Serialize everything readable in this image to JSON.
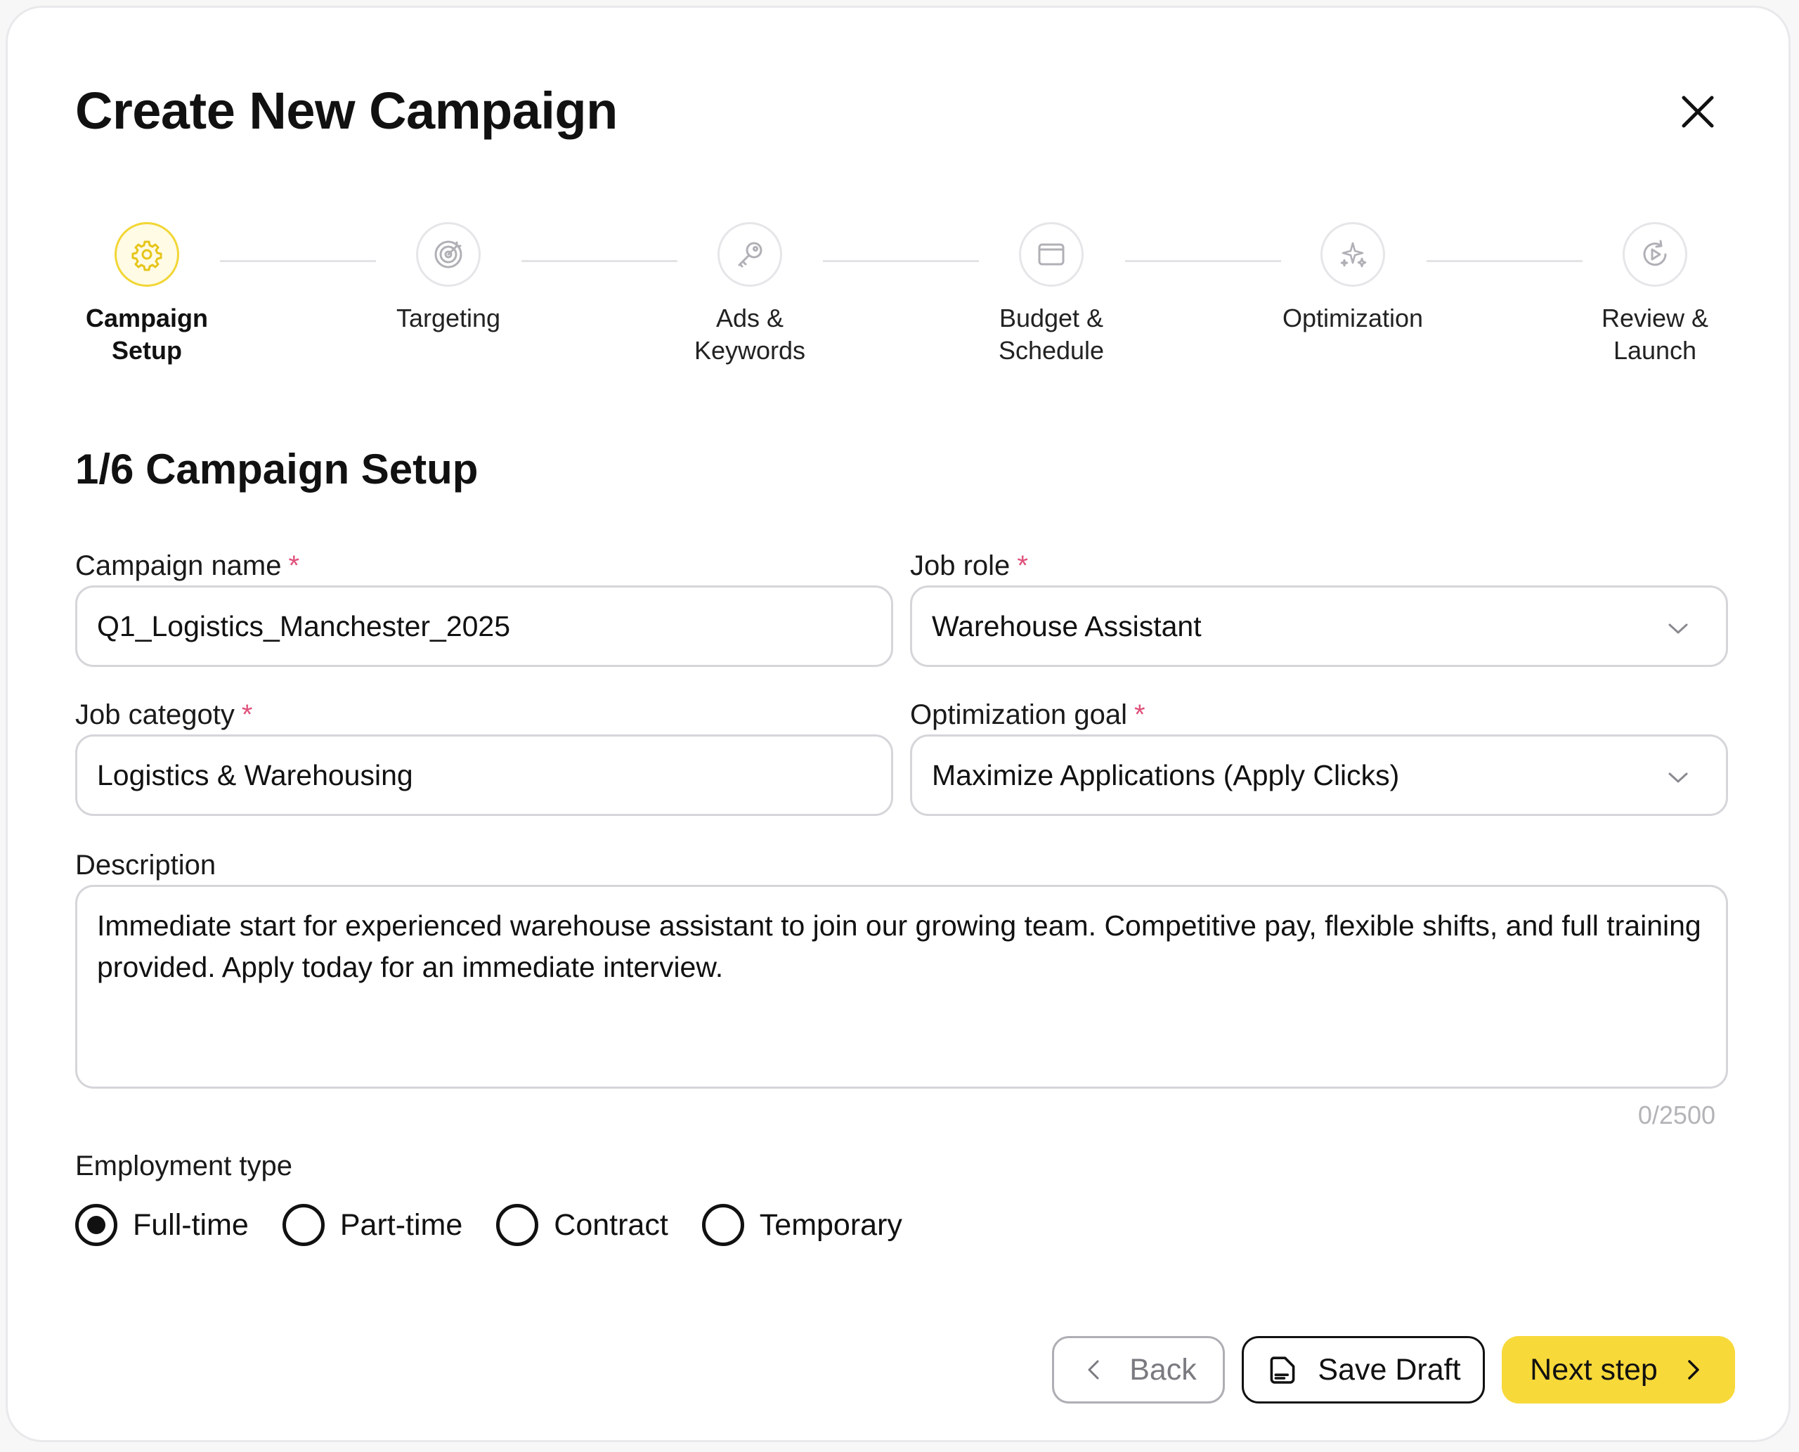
{
  "header": {
    "title": "Create New Campaign"
  },
  "stepper": {
    "steps": [
      {
        "label": "Campaign\nSetup",
        "icon": "gear-icon",
        "active": true
      },
      {
        "label": "Targeting",
        "icon": "target-icon",
        "active": false
      },
      {
        "label": "Ads &\nKeywords",
        "icon": "key-icon",
        "active": false
      },
      {
        "label": "Budget &\nSchedule",
        "icon": "wallet-icon",
        "active": false
      },
      {
        "label": "Optimization",
        "icon": "sparkles-icon",
        "active": false
      },
      {
        "label": "Review &\nLaunch",
        "icon": "play-refresh-icon",
        "active": false
      }
    ]
  },
  "section": {
    "title": "1/6 Campaign Setup"
  },
  "form": {
    "campaign_name": {
      "label": "Campaign name",
      "required": "*",
      "value": "Q1_Logistics_Manchester_2025"
    },
    "job_role": {
      "label": "Job role",
      "required": "*",
      "value": "Warehouse Assistant"
    },
    "job_category": {
      "label": "Job categoty",
      "required": "*",
      "value": "Logistics & Warehousing"
    },
    "optimization_goal": {
      "label": "Optimization goal",
      "required": "*",
      "value": "Maximize Applications (Apply Clicks)"
    },
    "description": {
      "label": "Description",
      "value": "Immediate start for experienced warehouse assistant to join our growing team. Competitive pay, flexible shifts, and full training provided. Apply today for an immediate interview.",
      "counter": "0/2500"
    },
    "employment_type": {
      "label": "Employment type",
      "options": [
        "Full-time",
        "Part-time",
        "Contract",
        "Temporary"
      ],
      "selected": "Full-time"
    }
  },
  "footer": {
    "back_label": "Back",
    "save_label": "Save Draft",
    "next_label": "Next step"
  },
  "colors": {
    "accent": "#f8d93a",
    "required": "#e0507a",
    "border": "#d5d5da"
  }
}
